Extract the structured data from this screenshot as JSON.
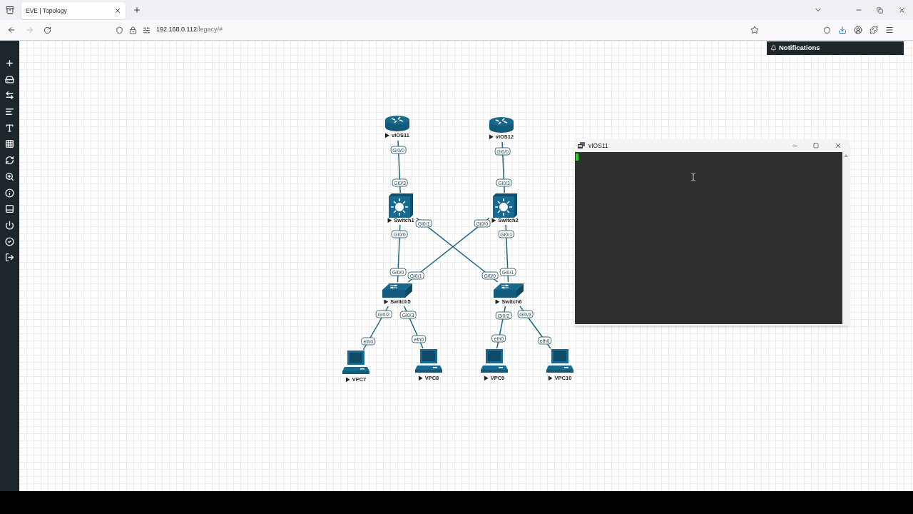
{
  "browser": {
    "tabs": [
      {
        "title": "EVE | Topology",
        "selected": true
      }
    ],
    "url": {
      "host": "192.168.0.112",
      "path": "/legacy/#"
    }
  },
  "notifications": {
    "label": "Notifications"
  },
  "nodes": [
    {
      "name": "vIOS11",
      "kind": "router"
    },
    {
      "name": "vIOS12",
      "kind": "router"
    },
    {
      "name": "Switch1",
      "kind": "l3switch"
    },
    {
      "name": "Switch2",
      "kind": "l3switch"
    },
    {
      "name": "Switch5",
      "kind": "switch"
    },
    {
      "name": "Switch6",
      "kind": "switch"
    },
    {
      "name": "VPC7",
      "kind": "pc"
    },
    {
      "name": "VPC8",
      "kind": "pc"
    },
    {
      "name": "VPC9",
      "kind": "pc"
    },
    {
      "name": "VPC10",
      "kind": "pc"
    }
  ],
  "links": [
    {
      "from_port": "Gi0/0",
      "to_port": "Gi0/3"
    },
    {
      "from_port": "Gi0/0",
      "to_port": "Gi0/3"
    },
    {
      "from_port": "Gi0/0",
      "to_port": "Gi0/0"
    },
    {
      "from_port": "Gi0/1",
      "to_port": "Gi0/0"
    },
    {
      "from_port": "Gi0/0",
      "to_port": "Gi0/1"
    },
    {
      "from_port": "Gi0/1",
      "to_port": "Gi0/1"
    },
    {
      "from_port": "Gi0/2",
      "to_port": "eth0"
    },
    {
      "from_port": "Gi0/3",
      "to_port": "eth0"
    },
    {
      "from_port": "Gi0/2",
      "to_port": "eth0"
    },
    {
      "from_port": "Gi0/3",
      "to_port": "eth0"
    }
  ],
  "console": {
    "title": "vIOS11"
  }
}
